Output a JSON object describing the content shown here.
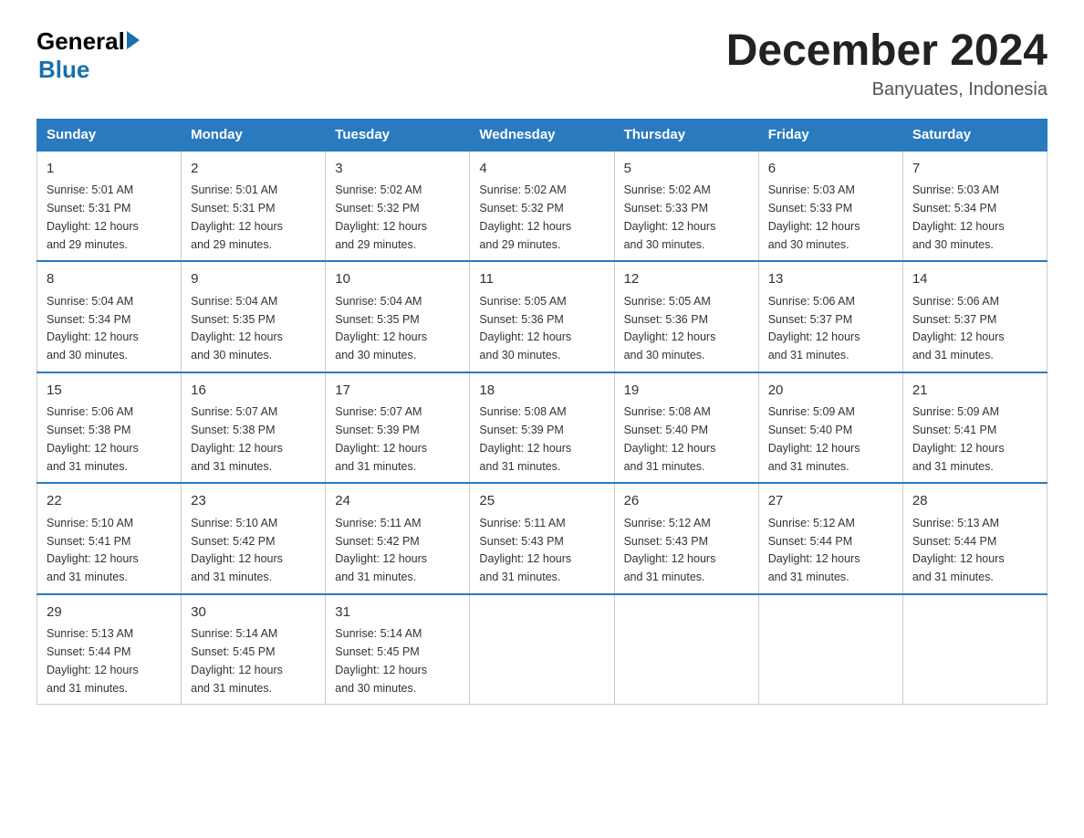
{
  "logo": {
    "general": "General",
    "blue": "Blue",
    "arrow": "▶"
  },
  "title": "December 2024",
  "location": "Banyuates, Indonesia",
  "days_header": [
    "Sunday",
    "Monday",
    "Tuesday",
    "Wednesday",
    "Thursday",
    "Friday",
    "Saturday"
  ],
  "weeks": [
    [
      {
        "day": "1",
        "sunrise": "5:01 AM",
        "sunset": "5:31 PM",
        "daylight": "12 hours and 29 minutes."
      },
      {
        "day": "2",
        "sunrise": "5:01 AM",
        "sunset": "5:31 PM",
        "daylight": "12 hours and 29 minutes."
      },
      {
        "day": "3",
        "sunrise": "5:02 AM",
        "sunset": "5:32 PM",
        "daylight": "12 hours and 29 minutes."
      },
      {
        "day": "4",
        "sunrise": "5:02 AM",
        "sunset": "5:32 PM",
        "daylight": "12 hours and 29 minutes."
      },
      {
        "day": "5",
        "sunrise": "5:02 AM",
        "sunset": "5:33 PM",
        "daylight": "12 hours and 30 minutes."
      },
      {
        "day": "6",
        "sunrise": "5:03 AM",
        "sunset": "5:33 PM",
        "daylight": "12 hours and 30 minutes."
      },
      {
        "day": "7",
        "sunrise": "5:03 AM",
        "sunset": "5:34 PM",
        "daylight": "12 hours and 30 minutes."
      }
    ],
    [
      {
        "day": "8",
        "sunrise": "5:04 AM",
        "sunset": "5:34 PM",
        "daylight": "12 hours and 30 minutes."
      },
      {
        "day": "9",
        "sunrise": "5:04 AM",
        "sunset": "5:35 PM",
        "daylight": "12 hours and 30 minutes."
      },
      {
        "day": "10",
        "sunrise": "5:04 AM",
        "sunset": "5:35 PM",
        "daylight": "12 hours and 30 minutes."
      },
      {
        "day": "11",
        "sunrise": "5:05 AM",
        "sunset": "5:36 PM",
        "daylight": "12 hours and 30 minutes."
      },
      {
        "day": "12",
        "sunrise": "5:05 AM",
        "sunset": "5:36 PM",
        "daylight": "12 hours and 30 minutes."
      },
      {
        "day": "13",
        "sunrise": "5:06 AM",
        "sunset": "5:37 PM",
        "daylight": "12 hours and 31 minutes."
      },
      {
        "day": "14",
        "sunrise": "5:06 AM",
        "sunset": "5:37 PM",
        "daylight": "12 hours and 31 minutes."
      }
    ],
    [
      {
        "day": "15",
        "sunrise": "5:06 AM",
        "sunset": "5:38 PM",
        "daylight": "12 hours and 31 minutes."
      },
      {
        "day": "16",
        "sunrise": "5:07 AM",
        "sunset": "5:38 PM",
        "daylight": "12 hours and 31 minutes."
      },
      {
        "day": "17",
        "sunrise": "5:07 AM",
        "sunset": "5:39 PM",
        "daylight": "12 hours and 31 minutes."
      },
      {
        "day": "18",
        "sunrise": "5:08 AM",
        "sunset": "5:39 PM",
        "daylight": "12 hours and 31 minutes."
      },
      {
        "day": "19",
        "sunrise": "5:08 AM",
        "sunset": "5:40 PM",
        "daylight": "12 hours and 31 minutes."
      },
      {
        "day": "20",
        "sunrise": "5:09 AM",
        "sunset": "5:40 PM",
        "daylight": "12 hours and 31 minutes."
      },
      {
        "day": "21",
        "sunrise": "5:09 AM",
        "sunset": "5:41 PM",
        "daylight": "12 hours and 31 minutes."
      }
    ],
    [
      {
        "day": "22",
        "sunrise": "5:10 AM",
        "sunset": "5:41 PM",
        "daylight": "12 hours and 31 minutes."
      },
      {
        "day": "23",
        "sunrise": "5:10 AM",
        "sunset": "5:42 PM",
        "daylight": "12 hours and 31 minutes."
      },
      {
        "day": "24",
        "sunrise": "5:11 AM",
        "sunset": "5:42 PM",
        "daylight": "12 hours and 31 minutes."
      },
      {
        "day": "25",
        "sunrise": "5:11 AM",
        "sunset": "5:43 PM",
        "daylight": "12 hours and 31 minutes."
      },
      {
        "day": "26",
        "sunrise": "5:12 AM",
        "sunset": "5:43 PM",
        "daylight": "12 hours and 31 minutes."
      },
      {
        "day": "27",
        "sunrise": "5:12 AM",
        "sunset": "5:44 PM",
        "daylight": "12 hours and 31 minutes."
      },
      {
        "day": "28",
        "sunrise": "5:13 AM",
        "sunset": "5:44 PM",
        "daylight": "12 hours and 31 minutes."
      }
    ],
    [
      {
        "day": "29",
        "sunrise": "5:13 AM",
        "sunset": "5:44 PM",
        "daylight": "12 hours and 31 minutes."
      },
      {
        "day": "30",
        "sunrise": "5:14 AM",
        "sunset": "5:45 PM",
        "daylight": "12 hours and 31 minutes."
      },
      {
        "day": "31",
        "sunrise": "5:14 AM",
        "sunset": "5:45 PM",
        "daylight": "12 hours and 30 minutes."
      },
      null,
      null,
      null,
      null
    ]
  ]
}
